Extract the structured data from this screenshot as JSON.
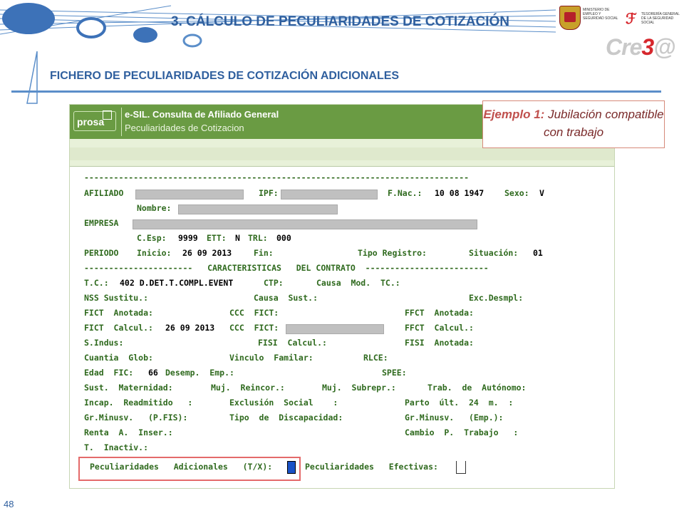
{
  "header": {
    "title": "3.  CÁLCULO DE PECULIARIDADES DE COTIZACIÓN",
    "subtitle": "FICHERO DE PECULIARIDADES DE COTIZACIÓN ADICIONALES",
    "logo_ministerio_text": "MINISTERIO DE EMPLEO Y SEGURIDAD SOCIAL",
    "logo_tgss_text": "TESORERÍA GENERAL DE LA SEGURIDAD SOCIAL",
    "logo_crea_prefix": "Cre",
    "logo_crea_three": "3",
    "logo_crea_suffix": "@"
  },
  "callout": {
    "bold": "Ejemplo 1:",
    "rest": " Jubilación compatible con trabajo"
  },
  "screen": {
    "brand": "prosa",
    "app_title": "e-SIL. Consulta de Afiliado General",
    "app_subtitle": "Peculiaridades de Cotizacion",
    "lines": {
      "l01": "------------------------------------------------------------------------------",
      "l02a": "AFILIADO",
      "l02b": "IPF:",
      "l02c": "F.Nac.:",
      "l02d": "10 08 1947",
      "l02e": "Sexo:",
      "l02f": "V",
      "l03a": "Nombre:",
      "l04a": "EMPRESA",
      "l05a": "C.Esp:",
      "l05b": "9999",
      "l05c": "ETT:",
      "l05d": "N",
      "l05e": "TRL:",
      "l05f": "000",
      "l06a": "PERIODO",
      "l06b": "Inicio:",
      "l06c": "26 09 2013",
      "l06d": "Fin:",
      "l06e": "Tipo Registro:",
      "l06f": "Situación:",
      "l06g": "01",
      "l07": "----------------------   CARACTERISTICAS   DEL CONTRATO  -------------------------",
      "l08a": "T.C.:",
      "l08b": "402 D.DET.T.COMPL.EVENT",
      "l08c": "CTP:",
      "l08d": "Causa  Mod.  TC.:",
      "l09a": "NSS Sustitu.:",
      "l09b": "Causa  Sust.:",
      "l09c": "Exc.Desmpl:",
      "l10a": "FICT  Anotada:",
      "l10b": "CCC  FICT:",
      "l10c": "FFCT  Anotada:",
      "l11a": "FICT  Calcul.:",
      "l11b": "26 09 2013",
      "l11c": "CCC  FICT:",
      "l11d": "FFCT  Calcul.:",
      "l12a": "S.Indus:",
      "l12b": "FISI  Calcul.:",
      "l12c": "FISI  Anotada:",
      "l13a": "Cuantia  Glob:",
      "l13b": "Vinculo  Familar:",
      "l13c": "RLCE:",
      "l14a": "Edad  FIC:",
      "l14b": "66",
      "l14c": "Desemp.  Emp.:",
      "l14d": "SPEE:",
      "l15a": "Sust.  Maternidad:",
      "l15b": "Muj.  Reincor.:",
      "l15c": "Muj.  Subrepr.:",
      "l15d": "Trab.  de  Autónomo:",
      "l16a": "Incap.  Readmitido   :",
      "l16b": "Exclusión  Social    :",
      "l16c": "Parto  últ.  24  m.  :",
      "l17a": "Gr.Minusv.   (P.FIS):",
      "l17b": "Tipo  de  Discapacidad:",
      "l17c": "Gr.Minusv.   (Emp.):",
      "l18a": "Renta  A.  Inser.:",
      "l18b": "Cambio  P.  Trabajo   :",
      "l19a": "T.  Inactiv.:",
      "l20a": "Peculiaridades   Adicionales   (T/X):",
      "l20b": "Peculiaridades   Efectivas:"
    }
  },
  "page_number": "48"
}
